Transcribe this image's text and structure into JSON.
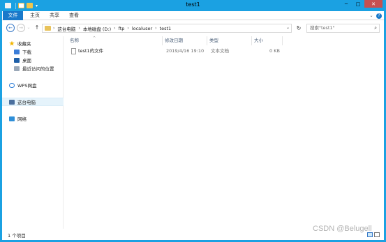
{
  "window": {
    "title": "test1",
    "colors": {
      "frame": "#1ba1e2",
      "file_tab": "#1979ca",
      "close": "#c75050"
    }
  },
  "quick_access": {
    "icons": [
      "properties-icon",
      "new-folder-icon",
      "folder-icon"
    ]
  },
  "title_buttons": {
    "minimize": "─",
    "maximize": "□",
    "close": "✕"
  },
  "ribbon": {
    "tabs": [
      {
        "label": "文件"
      },
      {
        "label": "主页"
      },
      {
        "label": "共享"
      },
      {
        "label": "查看"
      }
    ],
    "expand_glyph": "⌄",
    "help_glyph": "?"
  },
  "nav": {
    "back": "←",
    "forward": "→",
    "recent": "⌄",
    "up": "↑",
    "breadcrumb": [
      "这台电脑",
      "本地磁盘 (D:)",
      "ftp",
      "localuser",
      "test1"
    ],
    "chevron": "›",
    "dropdown": "⌄",
    "refresh": "↻",
    "search_placeholder": "搜索\"test1\"",
    "search_glyph": "⌕"
  },
  "sidebar": {
    "items": [
      {
        "label": "收藏夹",
        "icon": "star-icon"
      },
      {
        "label": "下载",
        "icon": "download-icon"
      },
      {
        "label": "桌面",
        "icon": "desktop-icon"
      },
      {
        "label": "最近访问的位置",
        "icon": "recent-places-icon"
      },
      {
        "label": "WPS网盘",
        "icon": "cloud-icon"
      },
      {
        "label": "这台电脑",
        "icon": "computer-icon",
        "selected": true
      },
      {
        "label": "网络",
        "icon": "network-icon"
      }
    ]
  },
  "columns": [
    {
      "label": "名称"
    },
    {
      "label": "修改日期"
    },
    {
      "label": "类型"
    },
    {
      "label": "大小"
    }
  ],
  "files": [
    {
      "name": "test1的文件",
      "modified": "2019/4/16 19:10",
      "type": "文本文档",
      "size": "0 KB"
    }
  ],
  "status": {
    "count": "1 个项目"
  },
  "watermark": "CSDN @Belugell"
}
